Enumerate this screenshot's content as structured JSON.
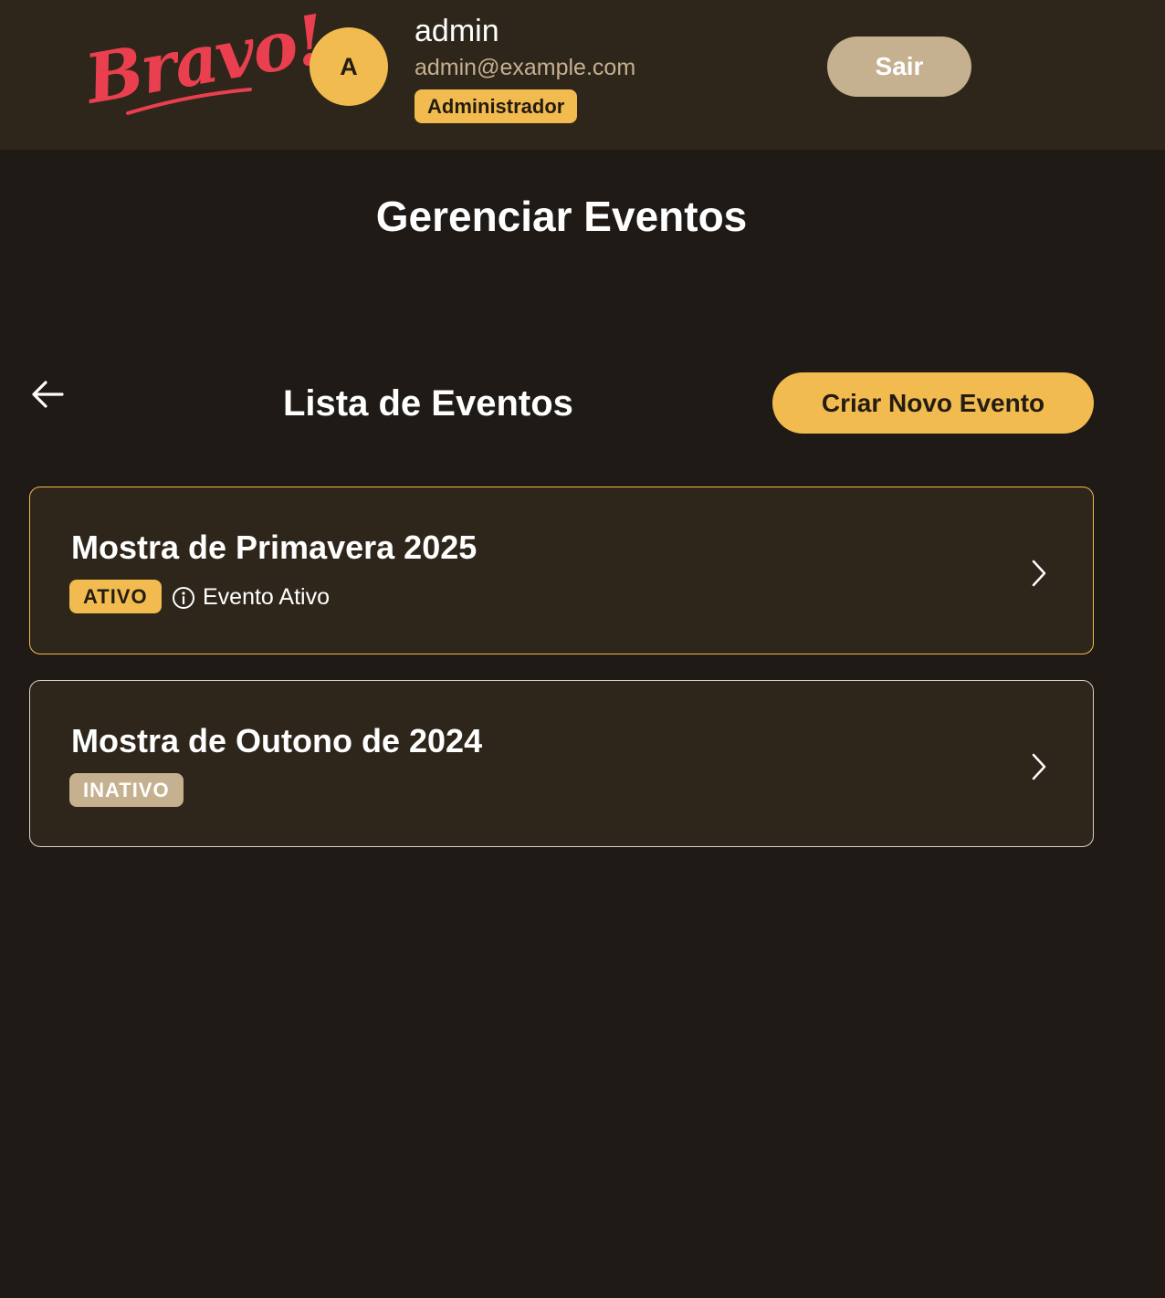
{
  "header": {
    "logo_text": "Bravo!",
    "avatar_initial": "A",
    "user_name": "admin",
    "user_email": "admin@example.com",
    "role_badge": "Administrador",
    "logout_label": "Sair"
  },
  "page": {
    "title": "Gerenciar Eventos"
  },
  "events_section": {
    "title": "Lista de Eventos",
    "create_button_label": "Criar Novo Evento"
  },
  "events": [
    {
      "title": "Mostra de Primavera 2025",
      "status": "ATIVO",
      "info_text": "Evento Ativo"
    },
    {
      "title": "Mostra de Outono de 2024",
      "status": "INATIVO"
    }
  ],
  "colors": {
    "background": "#1f1a15",
    "surface": "#2e261b",
    "accent": "#f2bb4f",
    "muted": "#c5b08f",
    "logo": "#ea3f4e"
  },
  "icons": {
    "back": "arrow-left-icon",
    "info": "info-circle-icon",
    "chevron": "chevron-right-icon"
  }
}
